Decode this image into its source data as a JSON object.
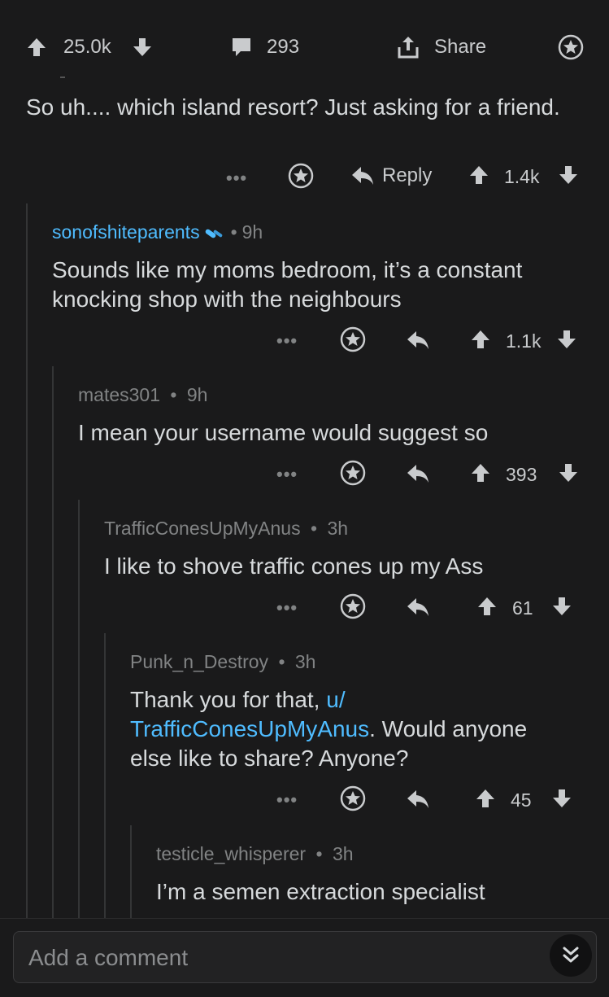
{
  "post_bar": {
    "upvotes": "25.0k",
    "comments": "293",
    "share_label": "Share"
  },
  "comments": [
    {
      "author": "",
      "age": "",
      "text": "So uh.... which island resort? Just asking for a friend.",
      "reply_label": "Reply",
      "score": "1.4k"
    },
    {
      "author": "sonofshiteparents",
      "age": "9h",
      "text": "Sounds like my moms bedroom, it’s a constant knocking shop with the neighbours",
      "score": "1.1k"
    },
    {
      "author": "mates301",
      "age": "9h",
      "text": "I mean your username would suggest so",
      "score": "393"
    },
    {
      "author": "TrafficConesUpMyAnus",
      "age": "3h",
      "text": "I like to shove traffic cones up my Ass",
      "score": "61"
    },
    {
      "author": "Punk_n_Destroy",
      "age": "3h",
      "text_before": "Thank you for that, ",
      "mention_line1": "u/",
      "mention_line2": "TrafficConesUpMyAnus",
      "text_after": ". Would anyone",
      "text_line3": "else like to share? Anyone?",
      "score": "45"
    },
    {
      "author": "testicle_whisperer",
      "age": "3h",
      "text": "I’m a semen extraction specialist"
    }
  ],
  "separator": "•",
  "more_dots": "•••",
  "composer": {
    "placeholder": "Add a comment"
  },
  "colors": {
    "background": "#1a1a1b",
    "text": "#d7dadc",
    "muted": "#818384",
    "link": "#4fbcff"
  }
}
